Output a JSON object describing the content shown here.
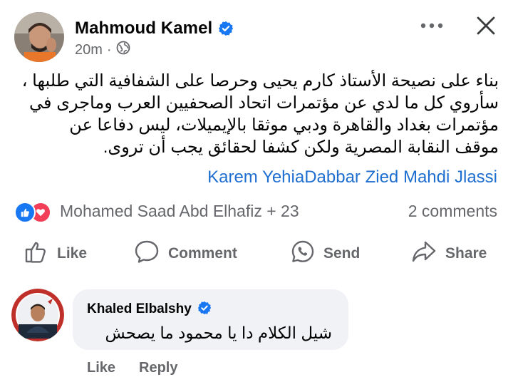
{
  "post": {
    "author": "Mahmoud Kamel",
    "time": "20m",
    "dot": "·",
    "text_lines": [
      "بناء على نصيحة الأستاذ كارم يحيى وحرصا على الشفافية التي طلبها ،",
      "سأروي كل ما لدي عن مؤتمرات اتحاد الصحفيين العرب وماجرى في",
      "مؤتمرات بغداد والقاهرة ودبي موثقا بالإيميلات، ليس دفاعا عن",
      "موقف النقابة المصرية ولكن كشفا لحقائق يجب أن تروى."
    ],
    "mentions": [
      "Karem Yehia",
      "Dabbar Zied",
      " ",
      "Mahdi Jlassi"
    ],
    "reactors": "Mohamed Saad Abd Elhafiz + 23",
    "comments_count": "2 comments"
  },
  "actions": {
    "like": "Like",
    "comment": "Comment",
    "send": "Send",
    "share": "Share"
  },
  "comment": {
    "author": "Khaled Elbalshy",
    "text": "شيل الكلام دا يا محمود ما يصحش",
    "like": "Like",
    "reply": "Reply"
  },
  "colors": {
    "verified": "#1877f2",
    "link": "#1e6fd0",
    "secondary_text": "#65676b",
    "like_reaction": "#1877f2",
    "love_reaction": "#f33e58",
    "bubble": "#f0f2f5"
  },
  "icons": [
    "more-icon",
    "close-icon",
    "globe-icon",
    "verified-badge-icon",
    "thumbs-up-icon",
    "comment-icon",
    "whatsapp-icon",
    "share-icon",
    "heart-icon"
  ]
}
